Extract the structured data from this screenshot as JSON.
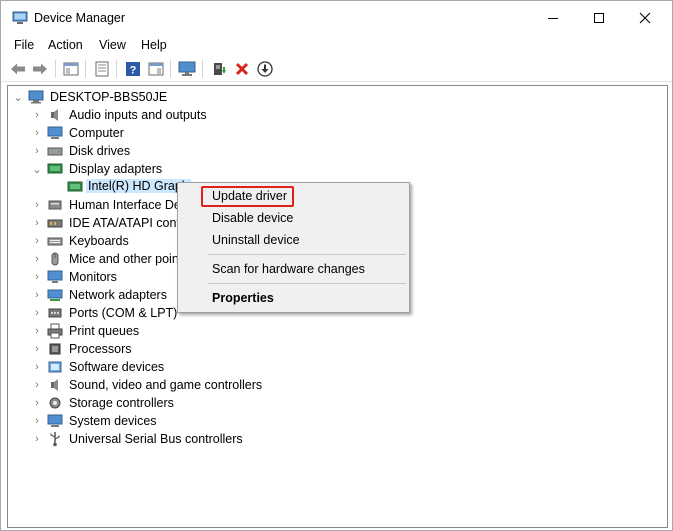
{
  "window": {
    "title": "Device Manager",
    "controls": {
      "minimize": "─",
      "maximize": "☐",
      "close": "✕"
    }
  },
  "menubar": {
    "items": [
      "File",
      "Action",
      "View",
      "Help"
    ]
  },
  "toolbar": {
    "buttons": [
      "back-icon",
      "forward-icon",
      "show-hide-console-tree-icon",
      "properties-icon",
      "help-icon",
      "action-pane-icon",
      "monitor-icon",
      "update-driver-icon",
      "uninstall-icon",
      "scan-hardware-icon"
    ]
  },
  "tree": {
    "root": "DESKTOP-BBS50JE",
    "categories": [
      "Audio inputs and outputs",
      "Computer",
      "Disk drives",
      "Display adapters",
      "Human Interface Dev",
      "IDE ATA/ATAPI contr",
      "Keyboards",
      "Mice and other point",
      "Monitors",
      "Network adapters",
      "Ports (COM & LPT)",
      "Print queues",
      "Processors",
      "Software devices",
      "Sound, video and game controllers",
      "Storage controllers",
      "System devices",
      "Universal Serial Bus controllers"
    ],
    "expanded_child": "Intel(R) HD Graph"
  },
  "context_menu": {
    "update_driver": "Update driver",
    "disable_device": "Disable device",
    "uninstall_device": "Uninstall device",
    "scan_hardware": "Scan for hardware changes",
    "properties": "Properties"
  },
  "colors": {
    "highlight_border": "#e0201b",
    "selection": "#cce8ff",
    "menu_bg": "#f0f0f0"
  }
}
